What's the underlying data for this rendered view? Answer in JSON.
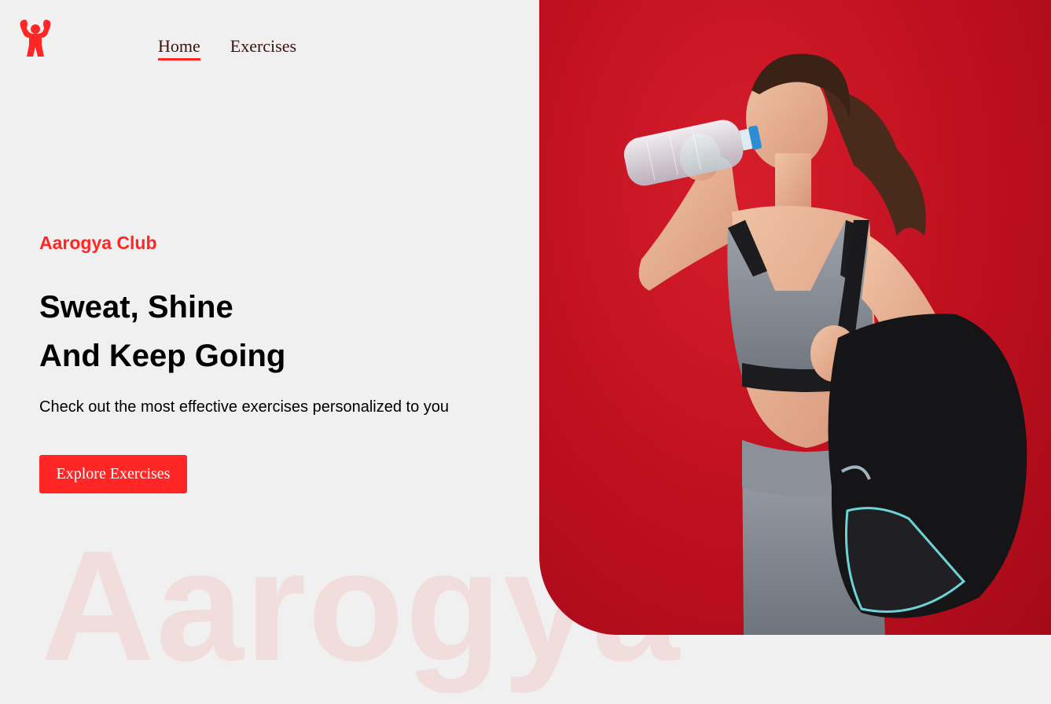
{
  "brand": {
    "logo_icon": "bodybuilder-icon",
    "accent_color": "#ff2625"
  },
  "nav": {
    "items": [
      {
        "label": "Home",
        "active": true
      },
      {
        "label": "Exercises",
        "active": false
      }
    ]
  },
  "hero": {
    "eyebrow": "Aarogya Club",
    "headline_line1": "Sweat, Shine",
    "headline_line2": "And Keep Going",
    "subtitle": "Check out the most effective exercises personalized to you",
    "cta_label": "Explore Exercises",
    "watermark": "Aarogya",
    "banner_image": "woman-drinking-water-with-gym-bag",
    "banner_background": "#c3121f"
  }
}
